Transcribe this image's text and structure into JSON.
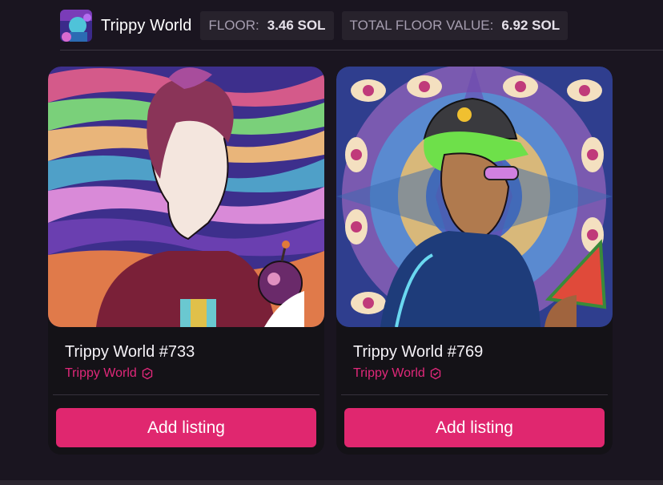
{
  "header": {
    "collection_name": "Trippy World",
    "floor_label": "FLOOR:",
    "floor_value": "3.46 SOL",
    "total_label": "TOTAL FLOOR VALUE:",
    "total_value": "6.92 SOL"
  },
  "cards": [
    {
      "title": "Trippy World #733",
      "collection": "Trippy World",
      "button": "Add listing"
    },
    {
      "title": "Trippy World #769",
      "collection": "Trippy World",
      "button": "Add listing"
    }
  ],
  "colors": {
    "accent": "#e0276f",
    "background": "#1a1520",
    "card": "#141217"
  }
}
